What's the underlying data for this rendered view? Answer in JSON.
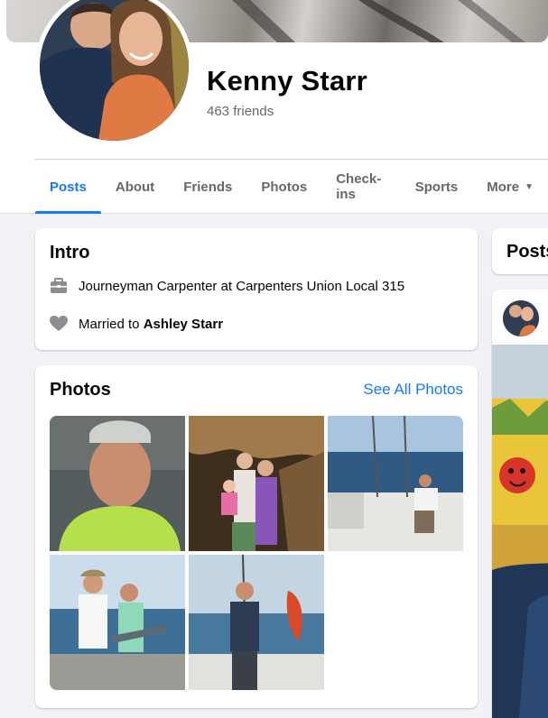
{
  "profile": {
    "name": "Kenny Starr",
    "friends": "463 friends"
  },
  "tabs": [
    {
      "label": "Posts",
      "active": true
    },
    {
      "label": "About"
    },
    {
      "label": "Friends"
    },
    {
      "label": "Photos"
    },
    {
      "label": "Check-ins"
    },
    {
      "label": "Sports"
    },
    {
      "label": "More"
    }
  ],
  "intro": {
    "title": "Intro",
    "job": "Journeyman Carpenter at Carpenters Union Local 315",
    "relationship_prefix": "Married to ",
    "relationship_name": "Ashley Starr"
  },
  "photos": {
    "title": "Photos",
    "see_all": "See All Photos"
  },
  "right": {
    "posts_title": "Posts"
  },
  "colors": {
    "accent": "#1877f2",
    "secondary_text": "#65676b",
    "background": "#f0f2f5"
  },
  "icons": {
    "job": "briefcase-icon",
    "relationship": "heart-icon",
    "more": "caret-down-icon"
  }
}
